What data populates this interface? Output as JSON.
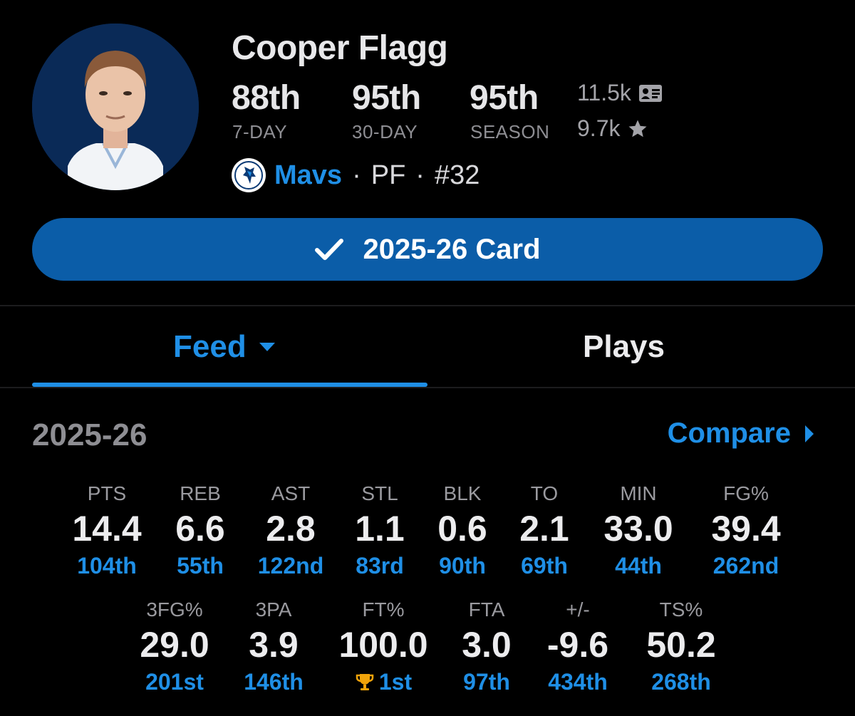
{
  "player": {
    "name": "Cooper Flagg",
    "team": "Mavs",
    "position": "PF",
    "number": "#32",
    "sep": "·"
  },
  "rankings": [
    {
      "value": "88th",
      "label": "7-DAY"
    },
    {
      "value": "95th",
      "label": "30-DAY"
    },
    {
      "value": "95th",
      "label": "SEASON"
    }
  ],
  "meta": {
    "cards_count": "11.5k",
    "favorites_count": "9.7k"
  },
  "card_button": {
    "label": "2025-26 Card"
  },
  "tabs": [
    {
      "label": "Feed",
      "active": true
    },
    {
      "label": "Plays",
      "active": false
    }
  ],
  "stats_header": {
    "season": "2025-26",
    "compare": "Compare"
  },
  "stats_row1": [
    {
      "label": "PTS",
      "value": "14.4",
      "rank": "104th"
    },
    {
      "label": "REB",
      "value": "6.6",
      "rank": "55th"
    },
    {
      "label": "AST",
      "value": "2.8",
      "rank": "122nd"
    },
    {
      "label": "STL",
      "value": "1.1",
      "rank": "83rd"
    },
    {
      "label": "BLK",
      "value": "0.6",
      "rank": "90th"
    },
    {
      "label": "TO",
      "value": "2.1",
      "rank": "69th"
    },
    {
      "label": "MIN",
      "value": "33.0",
      "rank": "44th"
    },
    {
      "label": "FG%",
      "value": "39.4",
      "rank": "262nd"
    }
  ],
  "stats_row2": [
    {
      "label": "3FG%",
      "value": "29.0",
      "rank": "201st"
    },
    {
      "label": "3PA",
      "value": "3.9",
      "rank": "146th"
    },
    {
      "label": "FT%",
      "value": "100.0",
      "rank": "1st",
      "trophy": true
    },
    {
      "label": "FTA",
      "value": "3.0",
      "rank": "97th"
    },
    {
      "label": "+/-",
      "value": "-9.6",
      "rank": "434th"
    },
    {
      "label": "TS%",
      "value": "50.2",
      "rank": "268th"
    }
  ],
  "colors": {
    "accent": "#1f8fe6",
    "button": "#0b5da8",
    "trophy": "#f0a30a",
    "muted": "#8e8e93"
  },
  "icons": [
    "id-card-icon",
    "star-icon",
    "checkmark-icon",
    "caret-down-icon",
    "caret-right-icon",
    "trophy-icon",
    "mavs-logo-icon"
  ]
}
